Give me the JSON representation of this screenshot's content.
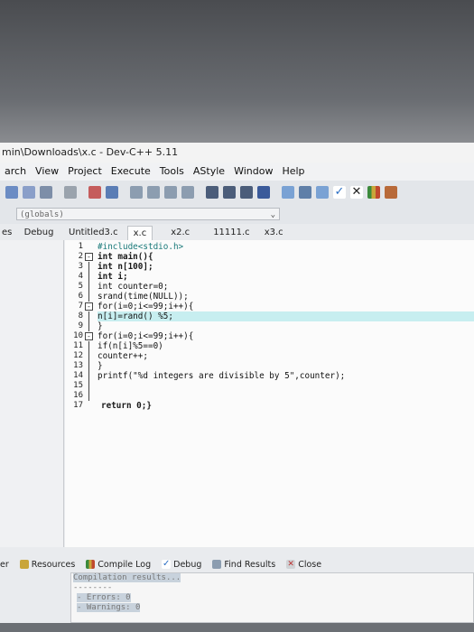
{
  "window": {
    "title": "min\\Downloads\\x.c - Dev-C++ 5.11"
  },
  "menu": [
    "arch",
    "View",
    "Project",
    "Execute",
    "Tools",
    "AStyle",
    "Window",
    "Help"
  ],
  "globals": {
    "value": "(globals)"
  },
  "left_tabs": [
    "es",
    "Debug"
  ],
  "file_tabs": [
    "Untitled3.c",
    "x.c",
    "x2.c",
    "11111.c",
    "x3.c"
  ],
  "active_tab": "x.c",
  "code": {
    "line_numbers": [
      "1",
      "2",
      "3",
      "4",
      "5",
      "6",
      "7",
      "8",
      "9",
      "10",
      "11",
      "12",
      "13",
      "14",
      "15",
      "16",
      "17"
    ],
    "lines": [
      "#include<stdio.h>",
      "int main(){",
      "int n[100];",
      "int i;",
      "int counter=0;",
      "srand(time(NULL));",
      "for(i=0;i<=99;i++){",
      "n[i]=rand() %5;",
      "}",
      "for(i=0;i<=99;i++){",
      "if(n[i]%5==0)",
      "counter++;",
      "}",
      "printf(\"%d integers are divisible by 5\",counter);",
      "",
      "",
      "return 0;}"
    ],
    "highlighted_line": 8,
    "fold_markers": [
      "-",
      "-",
      "-"
    ]
  },
  "bottom_tabs": [
    "er",
    "Resources",
    "Compile Log",
    "Debug",
    "Find Results",
    "Close"
  ],
  "compile_log": [
    "Compilation results...",
    "--------",
    "- Errors: 0",
    "- Warnings: 0"
  ],
  "colors": {
    "highlight": "#c7eef0",
    "number": "#7b2bd1",
    "string": "#1f48c9"
  },
  "icons": [
    "new-file-icon",
    "open-icon",
    "save-icon",
    "print-icon",
    "undo-icon",
    "redo-icon",
    "compile-icon",
    "run-icon",
    "check-icon",
    "close-icon",
    "chart-icon"
  ]
}
